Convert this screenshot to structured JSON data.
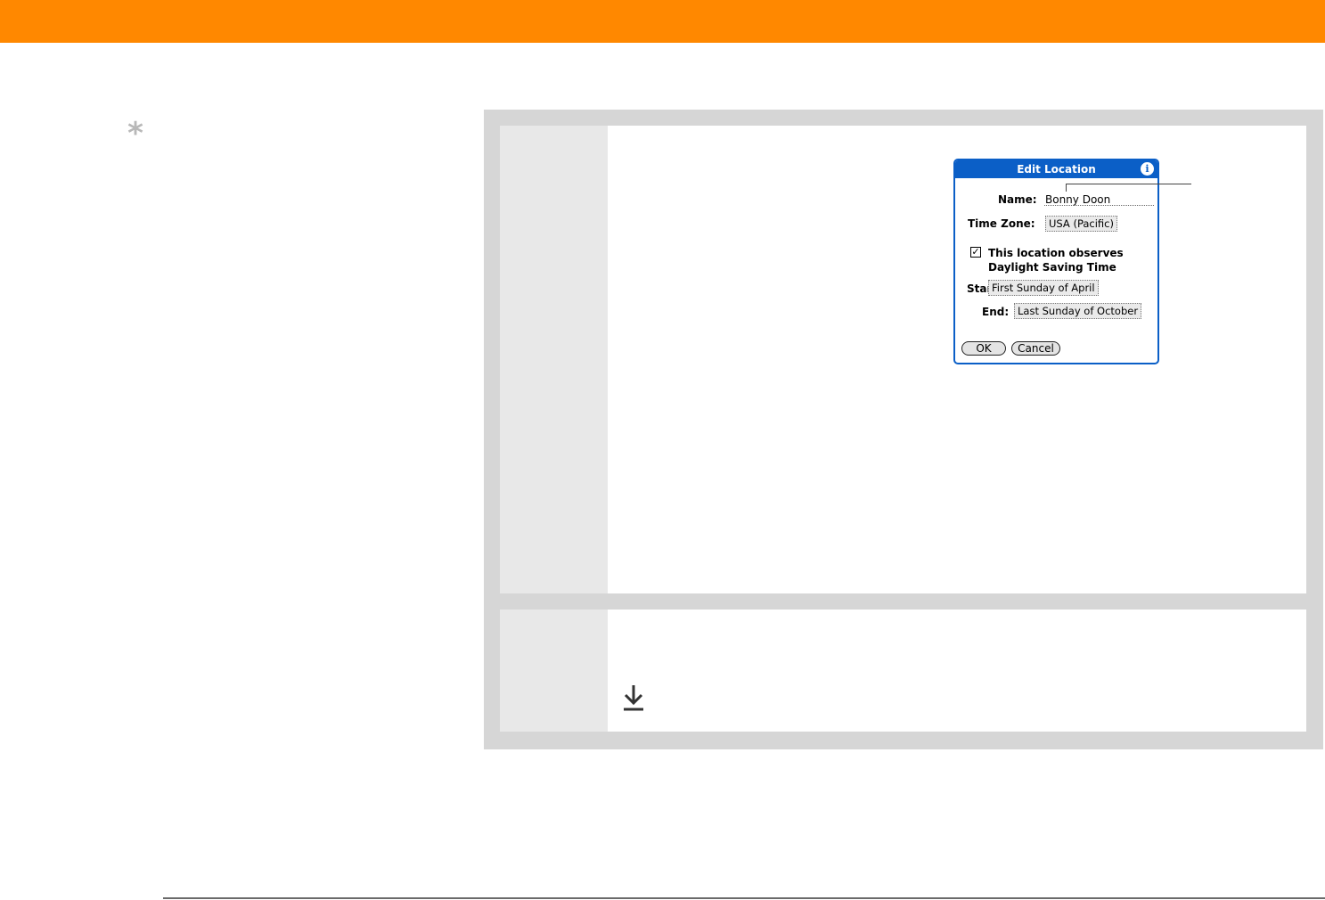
{
  "page": {
    "accent_color": "#ff8800",
    "tip_icon": "asterisk-icon",
    "continue_icon": "down-arrow-icon"
  },
  "dialog": {
    "title": "Edit Location",
    "title_bar_color": "#0b5fc7",
    "info_icon": "i",
    "name_label": "Name:",
    "name_value": "Bonny Doon",
    "timezone_label": "Time Zone:",
    "timezone_value": "USA (Pacific)",
    "checkbox_mark": "✓",
    "dst_line1": "This location observes",
    "dst_line2": "Daylight Saving Time",
    "start_label": "Start:",
    "start_value": "First Sunday of April",
    "end_label": "End:",
    "end_value": "Last Sunday of October",
    "ok_label": "OK",
    "cancel_label": "Cancel"
  }
}
